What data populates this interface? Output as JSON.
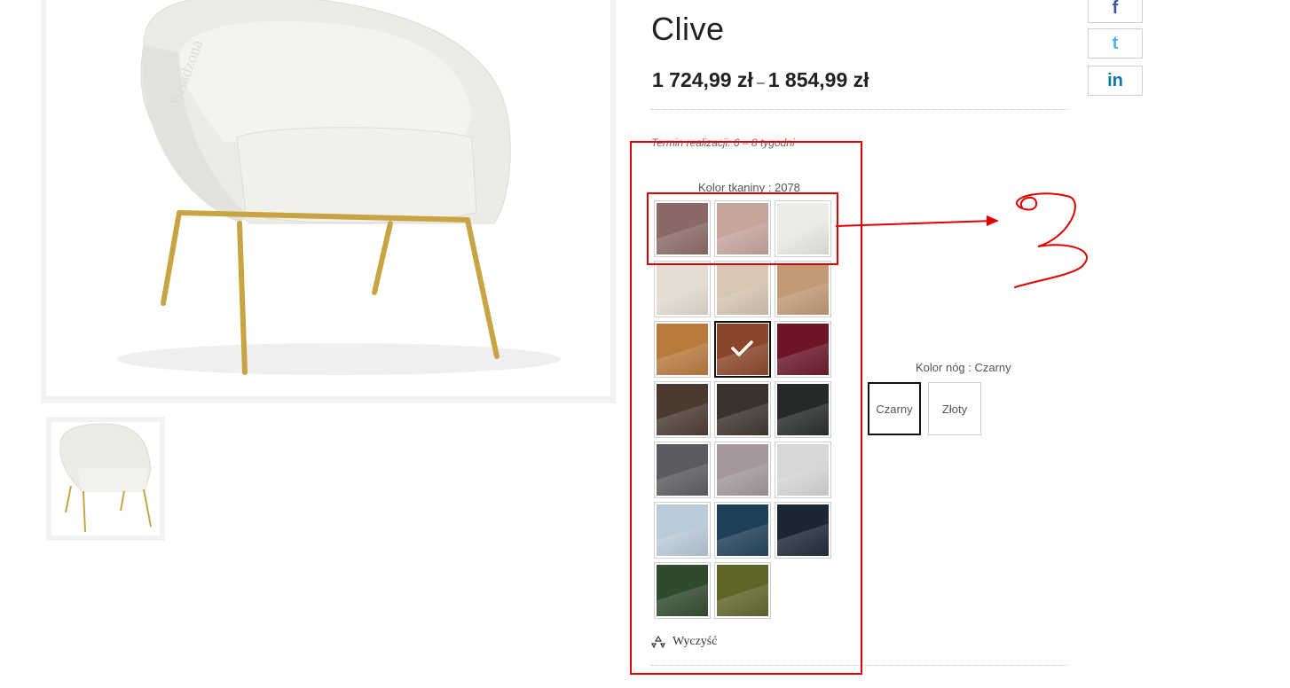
{
  "product": {
    "title": "Clive",
    "price_min": "1 724,99 zł",
    "price_sep": "–",
    "price_max": "1 854,99 zł",
    "lead_time": "Termin realizacji: 6 – 8 tygodni",
    "watermark": "Posadzona"
  },
  "fabric": {
    "label": "Kolor tkaniny : 2078",
    "swatches": [
      {
        "color": "#8a6a66",
        "name": "fabric-swatch-1"
      },
      {
        "color": "#c7a59c",
        "name": "fabric-swatch-2"
      },
      {
        "color": "#ecebe6",
        "name": "fabric-swatch-3"
      },
      {
        "color": "#e4ddd2",
        "name": "fabric-swatch-4"
      },
      {
        "color": "#d7c6b2",
        "name": "fabric-swatch-5"
      },
      {
        "color": "#c29a73",
        "name": "fabric-swatch-6"
      },
      {
        "color": "#b97a3c",
        "name": "fabric-swatch-7"
      },
      {
        "color": "#8b4528",
        "name": "fabric-swatch-8",
        "selected": true
      },
      {
        "color": "#6b1526",
        "name": "fabric-swatch-9"
      },
      {
        "color": "#4a3a30",
        "name": "fabric-swatch-10"
      },
      {
        "color": "#3a322c",
        "name": "fabric-swatch-11"
      },
      {
        "color": "#262a27",
        "name": "fabric-swatch-12"
      },
      {
        "color": "#5a5b60",
        "name": "fabric-swatch-13"
      },
      {
        "color": "#a4989a",
        "name": "fabric-swatch-14"
      },
      {
        "color": "#d7d7d7",
        "name": "fabric-swatch-15"
      },
      {
        "color": "#b9cbd8",
        "name": "fabric-swatch-16"
      },
      {
        "color": "#1e3f58",
        "name": "fabric-swatch-17"
      },
      {
        "color": "#1c2736",
        "name": "fabric-swatch-18"
      },
      {
        "color": "#2f4a2c",
        "name": "fabric-swatch-19"
      },
      {
        "color": "#5f6528",
        "name": "fabric-swatch-20"
      }
    ],
    "clear_label": "Wyczyść"
  },
  "legs": {
    "label": "Kolor nóg : Czarny",
    "options": [
      {
        "label": "Czarny",
        "selected": true
      },
      {
        "label": "Złoty",
        "selected": false
      }
    ]
  },
  "social": {
    "facebook": "f",
    "twitter": "t",
    "linkedin": "in"
  },
  "annotation": {
    "color": "#e00000",
    "digit": "3"
  },
  "colors": {
    "accent_annotation": "#e00000",
    "facebook": "#3b5998",
    "twitter": "#55acee",
    "linkedin": "#0e76a8"
  }
}
